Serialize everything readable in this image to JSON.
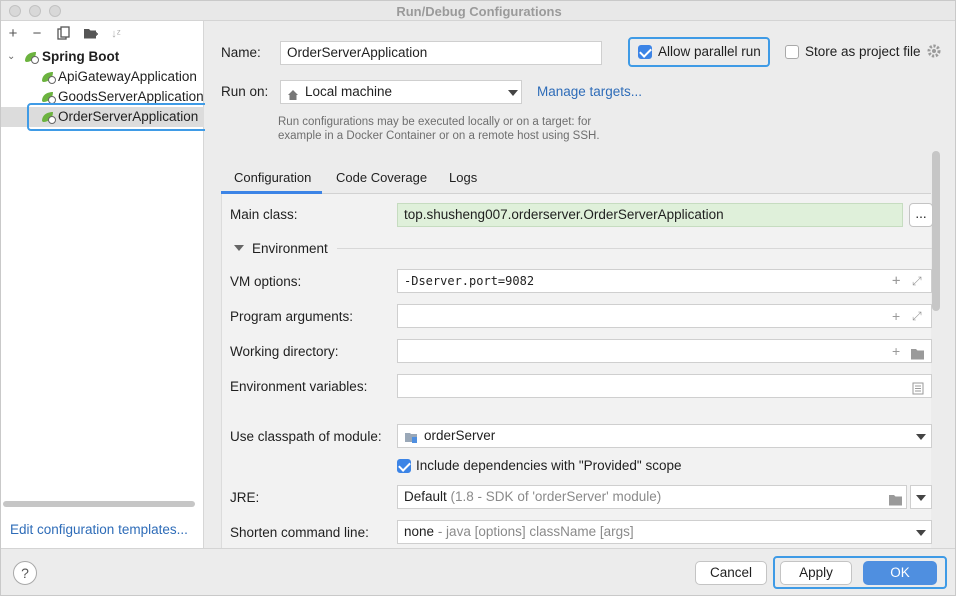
{
  "window": {
    "title": "Run/Debug Configurations"
  },
  "left_toolbar": {
    "add_icon": "plus-icon",
    "remove_icon": "minus-icon",
    "copy_icon": "copy-icon",
    "folder_icon": "new-folder-icon",
    "sort_icon": "sort-icon"
  },
  "tree": {
    "group": "Spring Boot",
    "items": [
      {
        "label": "ApiGatewayApplication"
      },
      {
        "label": "GoodsServerApplication"
      },
      {
        "label": "OrderServerApplication",
        "selected": true
      }
    ]
  },
  "left_footer": {
    "edit_templates": "Edit configuration templates..."
  },
  "form": {
    "name_label": "Name:",
    "name_value": "OrderServerApplication",
    "allow_parallel_label": "Allow parallel run",
    "allow_parallel_checked": true,
    "store_label": "Store as project file",
    "store_checked": false,
    "run_on_label": "Run on:",
    "run_on_value": "Local machine",
    "manage_targets": "Manage targets...",
    "hint_line1": "Run configurations may be executed locally or on a target: for",
    "hint_line2": "example in a Docker Container or on a remote host using SSH."
  },
  "tabs": [
    {
      "label": "Configuration",
      "active": true
    },
    {
      "label": "Code Coverage"
    },
    {
      "label": "Logs"
    }
  ],
  "configuration": {
    "main_class_label": "Main class:",
    "main_class_value": "top.shusheng007.orderserver.OrderServerApplication",
    "browse_label": "...",
    "environment_label": "Environment",
    "vm_options_label": "VM options:",
    "vm_options_value": "-Dserver.port=9082",
    "program_args_label": "Program arguments:",
    "program_args_value": "",
    "working_dir_label": "Working directory:",
    "working_dir_value": "",
    "env_vars_label": "Environment variables:",
    "env_vars_value": "",
    "classpath_label": "Use classpath of module:",
    "classpath_value": "orderServer",
    "include_deps_label": "Include dependencies with \"Provided\" scope",
    "include_deps_checked": true,
    "jre_label": "JRE:",
    "jre_value": "Default",
    "jre_detail": "(1.8 - SDK of 'orderServer' module)",
    "shorten_label": "Shorten command line:",
    "shorten_value": "none",
    "shorten_detail": "- java [options] className [args]"
  },
  "buttons": {
    "help": "?",
    "cancel": "Cancel",
    "apply": "Apply",
    "ok": "OK"
  },
  "colors": {
    "accent": "#3c84e6",
    "highlight_outline": "#3f9be6",
    "main_class_bg": "#dff0da"
  }
}
